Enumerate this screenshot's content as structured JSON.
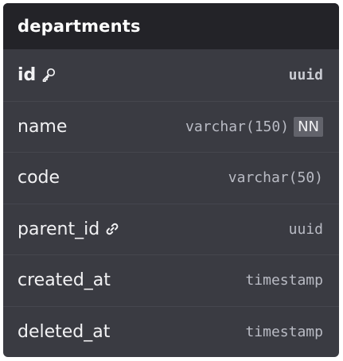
{
  "table": {
    "title": "departments",
    "columns": [
      {
        "name": "id",
        "type": "uuid",
        "icon": "key-icon",
        "primary_key": true,
        "badge": ""
      },
      {
        "name": "name",
        "type": "varchar(150)",
        "icon": "",
        "primary_key": false,
        "badge": "NN"
      },
      {
        "name": "code",
        "type": "varchar(50)",
        "icon": "",
        "primary_key": false,
        "badge": ""
      },
      {
        "name": "parent_id",
        "type": "uuid",
        "icon": "link-icon",
        "primary_key": false,
        "badge": ""
      },
      {
        "name": "created_at",
        "type": "timestamp",
        "icon": "",
        "primary_key": false,
        "badge": ""
      },
      {
        "name": "deleted_at",
        "type": "timestamp",
        "icon": "",
        "primary_key": false,
        "badge": ""
      }
    ]
  },
  "colors": {
    "header_bg": "#232328",
    "body_bg": "#3a3b42",
    "badge_bg": "#62636b"
  }
}
